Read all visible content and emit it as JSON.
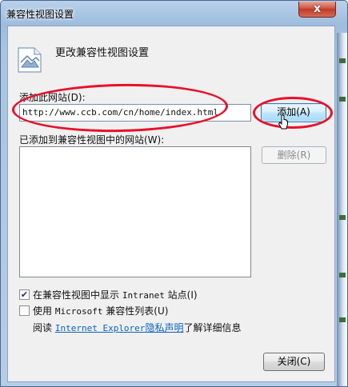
{
  "window": {
    "title": "兼容性视图设置",
    "close_glyph": "x"
  },
  "header": {
    "icon": "page-picture-icon",
    "text": "更改兼容性视图设置"
  },
  "add_site": {
    "label": "添加此网站(D):",
    "input_value": "http://www.ccb.com/cn/home/index.html",
    "add_button": "添加(A)"
  },
  "added_sites": {
    "label": "已添加到兼容性视图中的网站(W):",
    "items": [],
    "remove_button": "删除(R)"
  },
  "options": {
    "intranet": {
      "prefix": "在兼容性视图中显示",
      "mono": "Intranet",
      "suffix": "站点(I)",
      "checked": true
    },
    "microsoft_list": {
      "prefix": "使用",
      "mono": "Microsoft",
      "suffix": "兼容性列表(U)",
      "checked": false
    }
  },
  "privacy": {
    "prefix": "阅读",
    "link_mono": "Internet Explorer",
    "link_text": "隐私声明",
    "suffix": "了解详细信息"
  },
  "footer": {
    "close_button": "关闭(C)"
  },
  "colors": {
    "annotation": "#e8102a",
    "link": "#0b62c4",
    "focus_border": "#3c7fb1"
  }
}
